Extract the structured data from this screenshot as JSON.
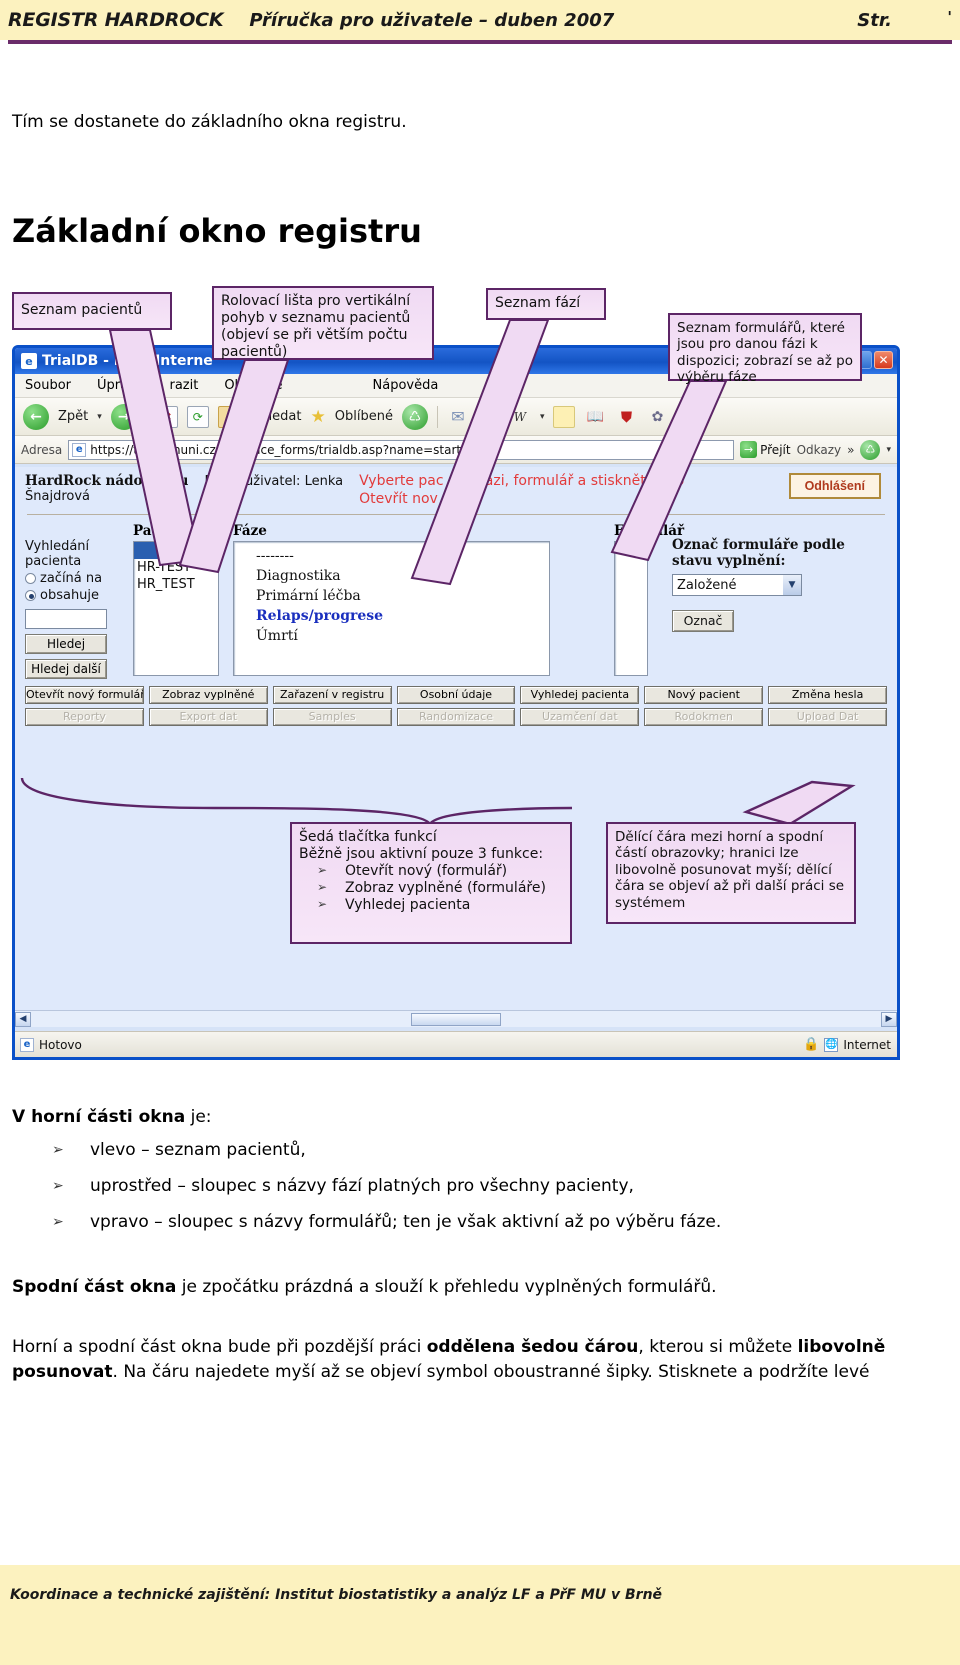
{
  "header": {
    "left": "REGISTR HARDROCK",
    "middle": "Příručka pro uživatele – duben 2007",
    "right": "Str.",
    "page_mark": "'"
  },
  "intro_paragraph": "Tím se dostanete do základního okna registru.",
  "section_title": "Základní okno registru",
  "callouts": {
    "patients_list": "Seznam pacientů",
    "scrollbar": "Rolovací lišta pro vertikální pohyb v seznamu pacientů (objeví se při větším počtu pacientů)",
    "phases_list": "Seznam fází",
    "forms_list": "Seznam formulářů, které jsou pro danou fázi k dispozici; zobrazí se až po výběru fáze",
    "grey_buttons_title": "Šedá tlačítka funkcí",
    "grey_buttons_sub": "Běžně jsou aktivní pouze 3 funkce:",
    "grey_buttons_items": [
      "Otevřít nový (formulář)",
      "Zobraz vyplněné (formuláře)",
      "Vyhledej pacienta"
    ],
    "divider_note": "Dělící čára mezi horní a spodní částí obrazovky; hranici lze libovolně posunovat myší; dělící čára se objeví až při další práci se systémem"
  },
  "browser": {
    "title": "TrialDB - Mi            ft Interne",
    "menu": [
      "Soubor",
      "Úpravy",
      "razit",
      "Oblíbené",
      "Nápověda"
    ],
    "toolbar": {
      "back": "Zpět",
      "search": "Hledat",
      "favorites": "Oblíbené"
    },
    "address_label": "Adresa",
    "address_value": "https://tri         ba.muni.cz/tri            erface_forms/trialdb.asp?name=starttri",
    "go_label": "Přejít",
    "links_label": "Odkazy",
    "status": "Hotovo",
    "zone": "Internet"
  },
  "app": {
    "title": "HardRock nádory        rku",
    "user_label": "Přihlá            uživatel: Lenka",
    "user_name": "Šnajdrová",
    "note_line1": "Vyberte pac        nta, fázi, formulář a stiskněte         ítko",
    "note_line2": "Otevřít nov",
    "logout": "Odhlášení",
    "search_panel": {
      "title_line1": "Vyhledání",
      "title_line2": "pacienta",
      "radio_starts": "začíná na",
      "radio_contains": "obsahuje",
      "input_value": "",
      "btn_search": "Hledej",
      "btn_search_next": "Hledej další"
    },
    "columns": {
      "patient": "Pacient/ID",
      "phase": "Fáze",
      "form": "Formulář"
    },
    "patients": [
      "",
      "HR-TEST",
      "HR_TEST"
    ],
    "phases": [
      "--------",
      "Diagnostika",
      "Primární léčba",
      "Relaps/progrese",
      "Úmrtí"
    ],
    "phase_highlighted": "Relaps/progrese",
    "mark_panel": {
      "label_line1": "Označ formuláře podle",
      "label_line2": "stavu vyplnění:",
      "select_value": "Založené",
      "button": "Označ"
    },
    "buttons_row1": [
      "Otevřít nový formulář",
      "Zobraz vyplněné",
      "Zařazení v registru",
      "Osobní údaje",
      "Vyhledej pacienta",
      "Nový pacient",
      "Změna hesla"
    ],
    "buttons_row2": [
      "Reporty",
      "Export dat",
      "Samples",
      "Randomizace",
      "Uzamčení dat",
      "Rodokmen",
      "Upload Dat"
    ]
  },
  "after_text": {
    "lead": "V horní části okna",
    "lead_rest": " je:",
    "bullets": [
      "vlevo – seznam pacientů,",
      "uprostřed – sloupec s názvy fází platných pro všechny pacienty,",
      "vpravo – sloupec s názvy formulářů; ten je však aktivní až po výběru fáze."
    ],
    "para2_bold": "Spodní část okna",
    "para2_rest": " je zpočátku prázdná a slouží k přehledu vyplněných formulářů.",
    "para3_p1": "Horní a spodní část okna bude při pozdější práci ",
    "para3_b1": "oddělena šedou čárou",
    "para3_p2": ", kterou si můžete ",
    "para3_b2": "libovolně",
    "para3_p3": " ",
    "para3_b3": "posunovat",
    "para3_p4": ". Na čáru najedete myší až se objeví symbol oboustranné šipky. Stisknete a podržíte levé"
  },
  "footer": "Koordinace a technické zajištění: Institut biostatistiky a analýz LF a PřF MU v Brně"
}
